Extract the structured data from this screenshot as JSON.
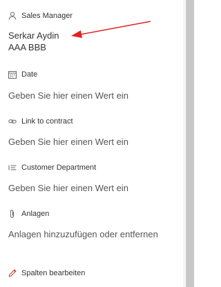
{
  "fields": {
    "sales_manager": {
      "label": "Sales Manager",
      "icon": "person-icon",
      "value_name": "Serkar Aydin",
      "value_extra": "AAA BBB"
    },
    "date": {
      "label": "Date",
      "icon": "calendar-icon",
      "placeholder": "Geben Sie hier einen Wert ein"
    },
    "link_to_contract": {
      "label": "Link to contract",
      "icon": "link-icon",
      "placeholder": "Geben Sie hier einen Wert ein"
    },
    "customer_department": {
      "label": "Customer Department",
      "icon": "list-choice-icon",
      "placeholder": "Geben Sie hier einen Wert ein"
    },
    "attachments": {
      "label": "Anlagen",
      "icon": "paperclip-icon",
      "placeholder": "Anlagen hinzuzufügen oder entfernen"
    }
  },
  "edit_columns": {
    "label": "Spalten bearbeiten",
    "icon": "pencil-icon"
  },
  "colors": {
    "annotation_arrow": "#e02020",
    "scrollbar_thumb": "#c8c8c8"
  }
}
